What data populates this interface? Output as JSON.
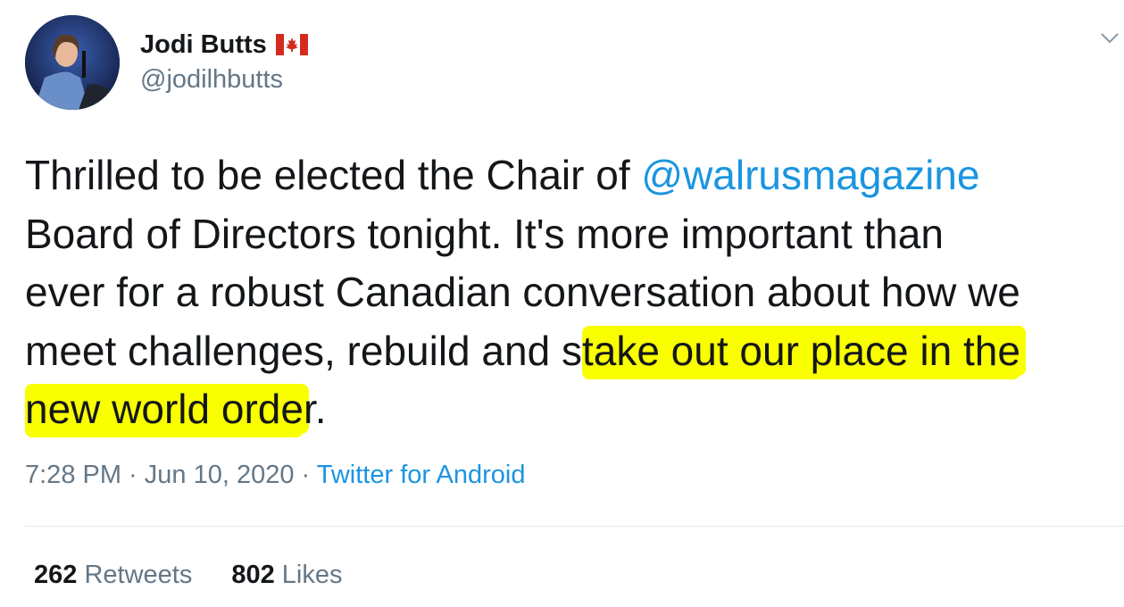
{
  "user": {
    "display_name": "Jodi Butts",
    "flag_icon": "canada-flag-icon",
    "handle": "@jodilhbutts"
  },
  "tweet": {
    "line1_pre": "Thrilled to be elected the Chair of ",
    "mention": "@walrusmagazine",
    "line2": "Board of Directors tonight. It's more important than",
    "line3": "ever for a robust Canadian conversation about how we",
    "line4_pre": "meet challenges, rebuild and s",
    "line4_highlight": "take out our place in the",
    "line5_highlight": "new world orde",
    "line5_post": "r."
  },
  "meta": {
    "time": "7:28 PM",
    "sep1": " · ",
    "date": "Jun 10, 2020",
    "sep2": " · ",
    "source": "Twitter for Android"
  },
  "stats": {
    "retweets_count": "262",
    "retweets_label": "Retweets",
    "likes_count": "802",
    "likes_label": "Likes"
  },
  "colors": {
    "link": "#1b95e0",
    "secondary": "#657786",
    "highlight": "#faff00"
  }
}
